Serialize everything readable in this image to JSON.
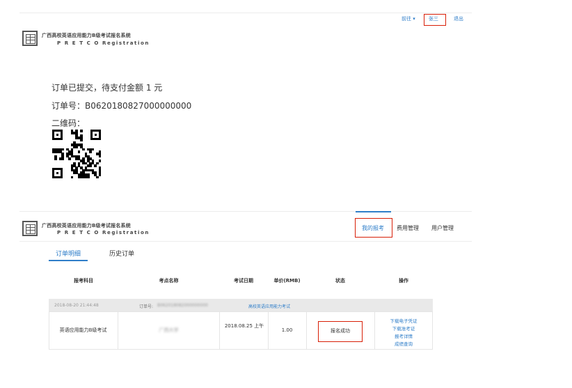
{
  "top_panel": {
    "nav": {
      "home": "前往 ▾",
      "user": "张三",
      "logout": "退出"
    },
    "system_title": "广西高校英语应用能力B级考试报名系统",
    "system_subtitle": "P R E T C O Registration",
    "order_submitted": "订单已提交，待支付金额 1 元",
    "order_number": "订单号：B0620180827000000000",
    "qr_label": "二维码：",
    "qr_icon": "qr-code"
  },
  "bottom_panel": {
    "system_title": "广西高校英语应用能力B级考试报名系统",
    "system_subtitle": "P R E T C O Registration",
    "nav": {
      "my_registration": "我的报考",
      "fee_management": "费用管理",
      "user_management": "用户管理"
    },
    "subtabs": {
      "order_details": "订单明细",
      "history_orders": "历史订单"
    },
    "table": {
      "headers": [
        "报考科目",
        "考点名称",
        "考试日期",
        "单价(RMB)",
        "状态",
        "操作"
      ],
      "order": {
        "time": "2018-08-20 21:44:48",
        "number_label": "订单号:",
        "number": "B062018082000000000",
        "exam_name": "高校英语应用能力考试"
      },
      "row": {
        "subject": "英语应用能力B级考试",
        "venue": "广西大学",
        "date": "2018.08.25 上午",
        "price": "1.00",
        "status": "报名成功",
        "actions": [
          "下载电子凭证",
          "下载准考证",
          "报考详情",
          "成绩查询"
        ]
      }
    }
  },
  "colors": {
    "link": "#2f7ec9",
    "highlight_border": "#d81e06",
    "order_row_bg": "#e9e9e9"
  }
}
